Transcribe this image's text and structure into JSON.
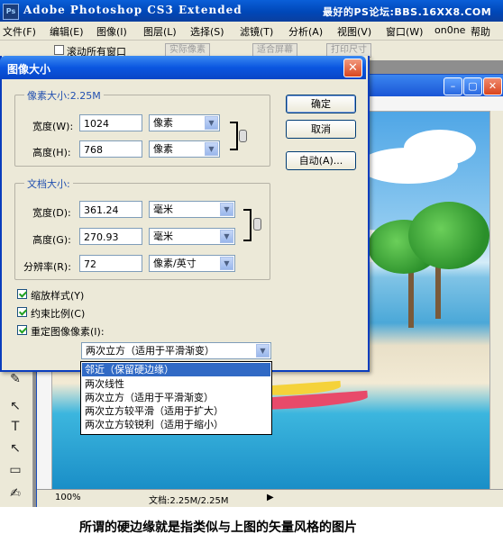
{
  "app": {
    "logo": "Ps",
    "title": "Adobe Photoshop CS3 Extended",
    "watermark": "最好的PS论坛:BBS.16XX8.COM"
  },
  "menu": [
    "文件(F)",
    "编辑(E)",
    "图像(I)",
    "图层(L)",
    "选择(S)",
    "滤镜(T)",
    "分析(A)",
    "视图(V)",
    "窗口(W)",
    "on0ne",
    "帮助(H)"
  ],
  "options_bar": {
    "checkbox_label": "滚动所有窗口",
    "buttons": [
      "实际像素",
      "适合屏幕",
      "打印尺寸"
    ]
  },
  "dialog": {
    "title": "图像大小",
    "pixel_group": {
      "title": "像素大小:2.25M",
      "width_label": "宽度(W):",
      "width_value": "1024",
      "width_unit": "像素",
      "height_label": "高度(H):",
      "height_value": "768",
      "height_unit": "像素"
    },
    "doc_group": {
      "title": "文档大小:",
      "width_label": "宽度(D):",
      "width_value": "361.24",
      "width_unit": "毫米",
      "height_label": "高度(G):",
      "height_value": "270.93",
      "height_unit": "毫米",
      "res_label": "分辨率(R):",
      "res_value": "72",
      "res_unit": "像素/英寸"
    },
    "buttons": {
      "ok": "确定",
      "cancel": "取消",
      "auto": "自动(A)..."
    },
    "checkboxes": {
      "scale_styles": "缩放样式(Y)",
      "constrain": "约束比例(C)",
      "resample": "重定图像像素(I):"
    },
    "resample_value": "两次立方（适用于平滑渐变）",
    "resample_options": [
      "邻近（保留硬边缘）",
      "两次线性",
      "两次立方（适用于平滑渐变）",
      "两次立方较平滑（适用于扩大）",
      "两次立方较锐利（适用于缩小）"
    ]
  },
  "document": {
    "zoom": "100%",
    "doc_size": "文档:2.25M/2.25M"
  },
  "caption": "所谓的硬边缘就是指类似与上图的矢量风格的图片",
  "colors": {
    "xp_blue": "#0a56e0",
    "dialog_bg": "#ece9d8",
    "selection": "#316ac5"
  }
}
